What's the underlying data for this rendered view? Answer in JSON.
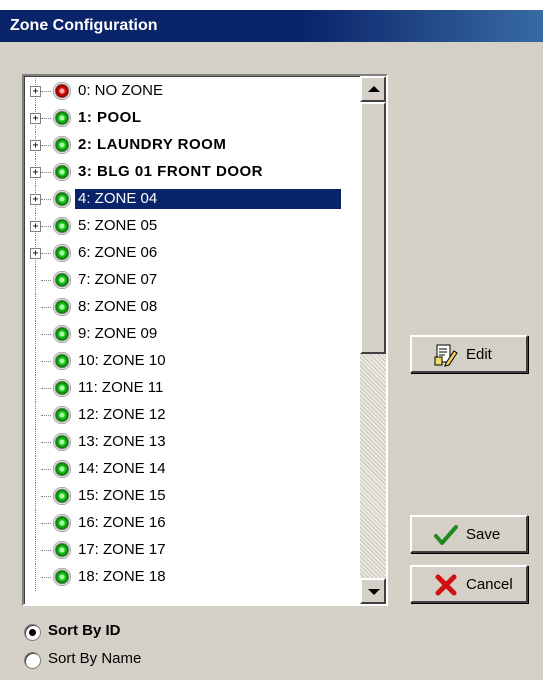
{
  "window": {
    "title": "Zone Configuration"
  },
  "zones": [
    {
      "label": "0: NO ZONE",
      "status": "red",
      "expandable": true,
      "bold": false,
      "selected": false
    },
    {
      "label": "1: POOL",
      "status": "green",
      "expandable": true,
      "bold": true,
      "selected": false
    },
    {
      "label": "2: LAUNDRY ROOM",
      "status": "green",
      "expandable": true,
      "bold": true,
      "selected": false
    },
    {
      "label": "3: BLG 01 FRONT DOOR",
      "status": "green",
      "expandable": true,
      "bold": true,
      "selected": false
    },
    {
      "label": "4: ZONE 04",
      "status": "green",
      "expandable": true,
      "bold": false,
      "selected": true
    },
    {
      "label": "5: ZONE 05",
      "status": "green",
      "expandable": true,
      "bold": false,
      "selected": false
    },
    {
      "label": "6: ZONE 06",
      "status": "green",
      "expandable": true,
      "bold": false,
      "selected": false
    },
    {
      "label": "7: ZONE 07",
      "status": "green",
      "expandable": false,
      "bold": false,
      "selected": false
    },
    {
      "label": "8: ZONE 08",
      "status": "green",
      "expandable": false,
      "bold": false,
      "selected": false
    },
    {
      "label": "9: ZONE 09",
      "status": "green",
      "expandable": false,
      "bold": false,
      "selected": false
    },
    {
      "label": "10: ZONE 10",
      "status": "green",
      "expandable": false,
      "bold": false,
      "selected": false
    },
    {
      "label": "11: ZONE 11",
      "status": "green",
      "expandable": false,
      "bold": false,
      "selected": false
    },
    {
      "label": "12: ZONE 12",
      "status": "green",
      "expandable": false,
      "bold": false,
      "selected": false
    },
    {
      "label": "13: ZONE 13",
      "status": "green",
      "expandable": false,
      "bold": false,
      "selected": false
    },
    {
      "label": "14: ZONE 14",
      "status": "green",
      "expandable": false,
      "bold": false,
      "selected": false
    },
    {
      "label": "15: ZONE 15",
      "status": "green",
      "expandable": false,
      "bold": false,
      "selected": false
    },
    {
      "label": "16: ZONE 16",
      "status": "green",
      "expandable": false,
      "bold": false,
      "selected": false
    },
    {
      "label": "17: ZONE 17",
      "status": "green",
      "expandable": false,
      "bold": false,
      "selected": false
    },
    {
      "label": "18: ZONE 18",
      "status": "green",
      "expandable": false,
      "bold": false,
      "selected": false
    }
  ],
  "buttons": {
    "edit": {
      "label": "Edit",
      "icon": "edit-document-icon"
    },
    "save": {
      "label": "Save",
      "icon": "checkmark-icon"
    },
    "cancel": {
      "label": "Cancel",
      "icon": "x-icon"
    }
  },
  "sort": {
    "options": [
      {
        "label": "Sort By ID",
        "selected": true
      },
      {
        "label": "Sort By Name",
        "selected": false
      }
    ]
  },
  "colors": {
    "titlebar": "#0a246a",
    "selection": "#0a246a",
    "status_ok": "#1ec81e",
    "status_alarm": "#e01010",
    "save_check": "#1f8a1f",
    "cancel_x": "#d01010"
  }
}
